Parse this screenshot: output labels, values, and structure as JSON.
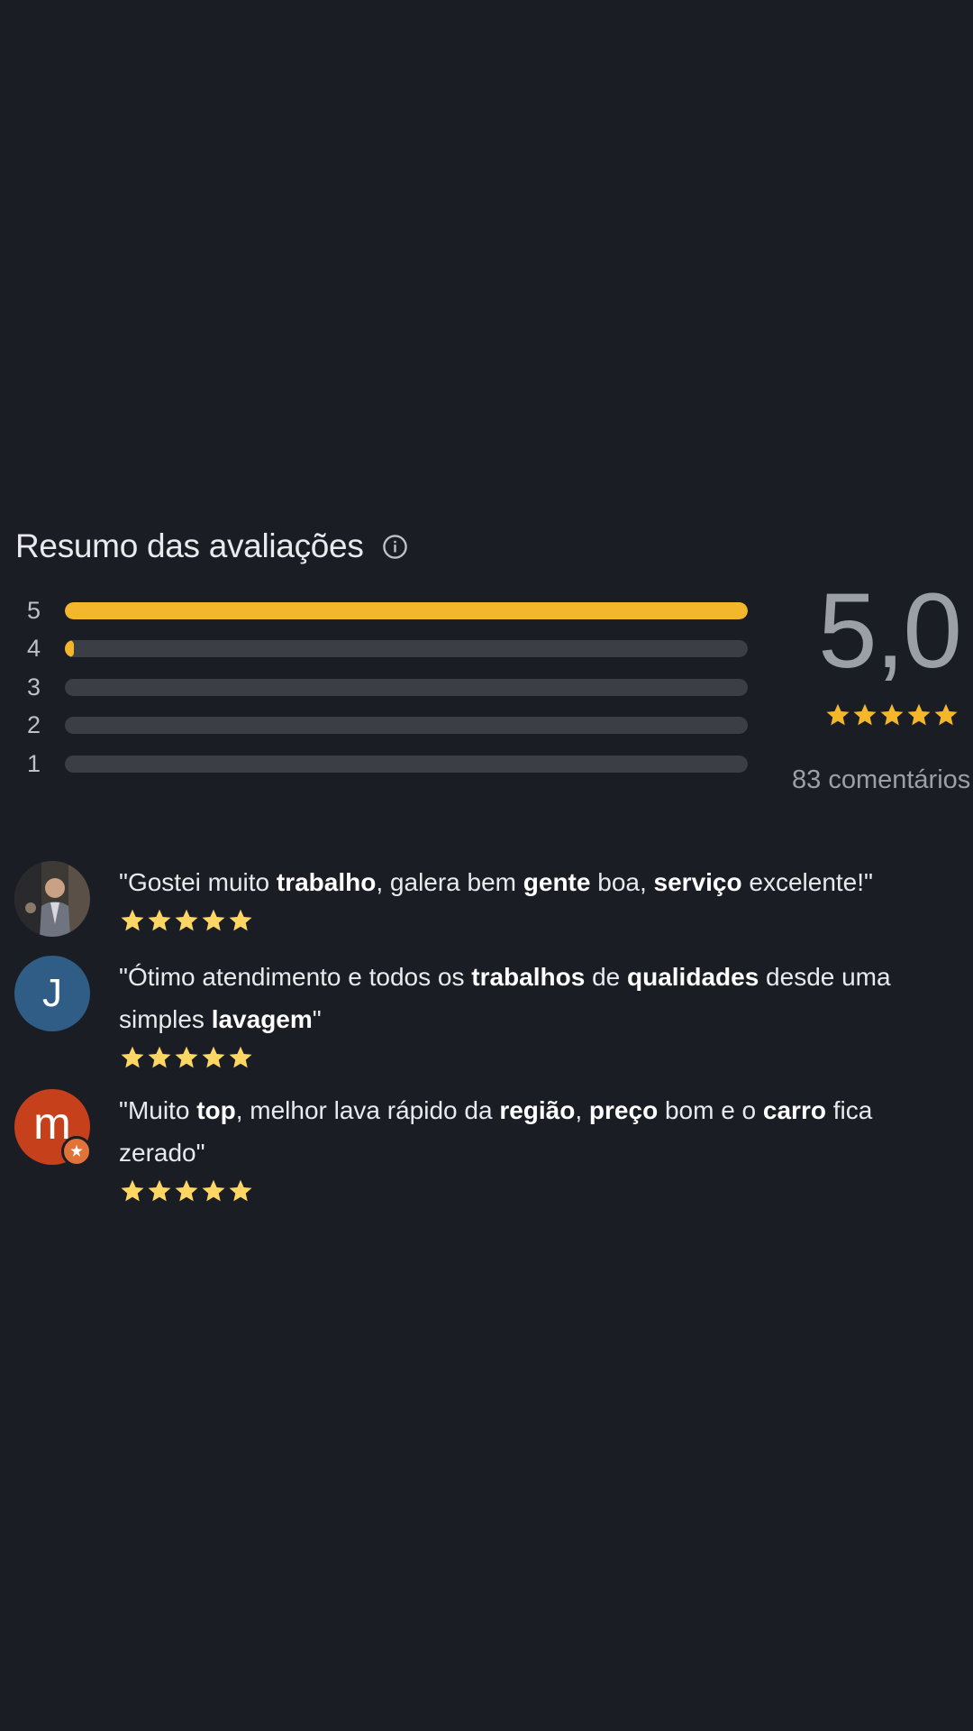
{
  "summary": {
    "title": "Resumo das avaliações",
    "info_icon": "info-icon"
  },
  "distribution": [
    {
      "label": "5",
      "fraction": 1.0
    },
    {
      "label": "4",
      "fraction": 0.012
    },
    {
      "label": "3",
      "fraction": 0.0
    },
    {
      "label": "2",
      "fraction": 0.0
    },
    {
      "label": "1",
      "fraction": 0.0
    }
  ],
  "score": {
    "value": "5,0",
    "stars": 5,
    "count_label": "83 comentários"
  },
  "reviews": [
    {
      "avatar": "user-photo",
      "segments": [
        {
          "t": "\"Gostei muito ",
          "b": false
        },
        {
          "t": "trabalho",
          "b": true
        },
        {
          "t": ", galera bem ",
          "b": false
        },
        {
          "t": "gente",
          "b": true
        },
        {
          "t": " boa, ",
          "b": false
        },
        {
          "t": "serviço",
          "b": true
        },
        {
          "t": " excelente!\"",
          "b": false
        }
      ],
      "stars": 5
    },
    {
      "avatar": "J",
      "segments": [
        {
          "t": "\"Ótimo atendimento e todos os ",
          "b": false
        },
        {
          "t": "trabalhos",
          "b": true
        },
        {
          "t": " de ",
          "b": false
        },
        {
          "t": "qualidades",
          "b": true
        },
        {
          "t": " desde uma simples ",
          "b": false
        },
        {
          "t": "lavagem",
          "b": true
        },
        {
          "t": "\"",
          "b": false
        }
      ],
      "stars": 5
    },
    {
      "avatar": "m",
      "segments": [
        {
          "t": "\"Muito ",
          "b": false
        },
        {
          "t": "top",
          "b": true
        },
        {
          "t": ", melhor lava rápido da ",
          "b": false
        },
        {
          "t": "região",
          "b": true
        },
        {
          "t": ", ",
          "b": false
        },
        {
          "t": "preço",
          "b": true
        },
        {
          "t": " bom e o ",
          "b": false
        },
        {
          "t": "carro",
          "b": true
        },
        {
          "t": " fica zerado\"",
          "b": false
        }
      ],
      "stars": 5
    }
  ],
  "colors": {
    "background": "#1b1d24",
    "star": "#f4b62b",
    "bar_track": "#3b3e44"
  }
}
